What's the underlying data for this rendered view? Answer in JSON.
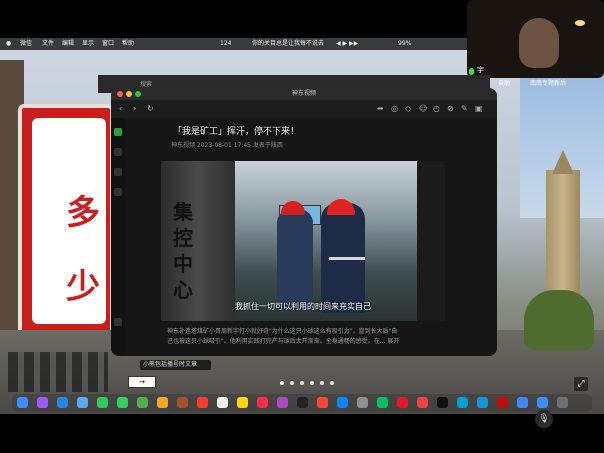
{
  "menubar": {
    "app": "微信",
    "items": [
      "文件",
      "编辑",
      "显示",
      "窗口",
      "帮助"
    ],
    "battery": "124",
    "marquee": "你的关目总是让我每不说去",
    "weather": "99%"
  },
  "pip": {
    "name": "宇"
  },
  "window": {
    "title": "神东视频",
    "back_tab": "搜索",
    "headline": "「我是矿工」挥汗，停不下来！",
    "meta": "神东视频  2023-08-01 17:45  发表于陕西",
    "photo_vertical_text": [
      "集",
      "控",
      "中",
      "心"
    ],
    "caption": "我抓住一切可以利用的时间来充实自己",
    "desc_line1": "神东补连塔煤矿小哥周新宇打小就好奇\"为什么这只小球这么有吸引力\"，直到长大后\"自",
    "desc_line2": "己也被这只小球吸引\"。他利用实践打完产与球后大开渐渐。全身通畅的感受。在...  展开"
  },
  "mini_window": {
    "label": "小熊包括播号时文章"
  },
  "right_sidebar": {
    "label1": "自助",
    "label2": "南南专题新后"
  },
  "desktop": {
    "sign_text": "多\n少"
  },
  "page_dots": 6,
  "colors": {
    "accent_red": "#e02222",
    "window_bg": "#161616",
    "titlebar_bg": "#2b2b2b"
  },
  "icons": {
    "back": "chevron-left-icon",
    "forward": "chevron-right-icon",
    "refresh": "refresh-icon",
    "toolbar": [
      "share-icon",
      "globe-icon",
      "heart-icon",
      "person-icon",
      "history-icon",
      "link-icon",
      "edit-icon",
      "info-icon"
    ],
    "expand": "expand-icon",
    "mute": "mic-off-icon"
  },
  "dock_apps": [
    "finder",
    "launchpad",
    "safari",
    "mail",
    "facetime",
    "messages",
    "maps",
    "photos",
    "contacts",
    "calendar",
    "reminders",
    "notes",
    "music",
    "podcasts",
    "tv",
    "news",
    "appstore",
    "settings",
    "wechat",
    "weibo",
    "toutiao",
    "douyin",
    "bilibili",
    "qq",
    "netease",
    "chrome",
    "finder2",
    "trash"
  ]
}
